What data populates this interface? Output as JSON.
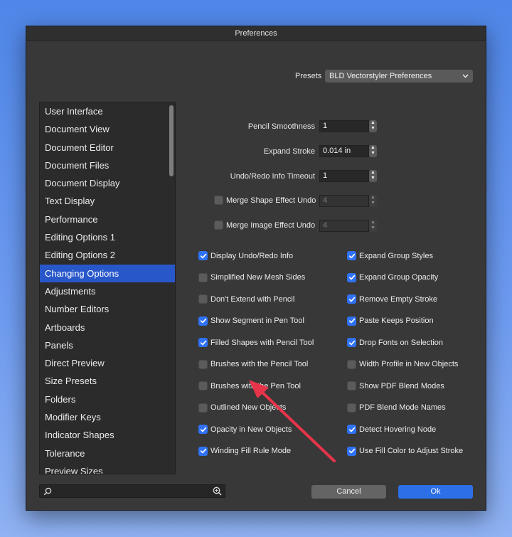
{
  "window": {
    "title": "Preferences"
  },
  "presets": {
    "label": "Presets",
    "selected": "BLD Vectorstyler Preferences"
  },
  "sidebar": {
    "items": [
      {
        "label": "User Interface"
      },
      {
        "label": "Document View"
      },
      {
        "label": "Document Editor"
      },
      {
        "label": "Document Files"
      },
      {
        "label": "Document Display"
      },
      {
        "label": "Text Display"
      },
      {
        "label": "Performance"
      },
      {
        "label": "Editing Options 1"
      },
      {
        "label": "Editing Options 2"
      },
      {
        "label": "Changing Options",
        "selected": true
      },
      {
        "label": "Adjustments"
      },
      {
        "label": "Number Editors"
      },
      {
        "label": "Artboards"
      },
      {
        "label": "Panels"
      },
      {
        "label": "Direct Preview"
      },
      {
        "label": "Size Presets"
      },
      {
        "label": "Folders"
      },
      {
        "label": "Modifier Keys"
      },
      {
        "label": "Indicator Shapes"
      },
      {
        "label": "Tolerance"
      },
      {
        "label": "Preview Sizes"
      }
    ]
  },
  "search": {
    "placeholder": ""
  },
  "fields": {
    "pencil_smoothness": {
      "label": "Pencil Smoothness",
      "value": "1"
    },
    "expand_stroke": {
      "label": "Expand Stroke",
      "value": "0.014 in"
    },
    "undo_redo_timeout": {
      "label": "Undo/Redo Info Timeout",
      "value": "1"
    },
    "merge_shape_effect_undo": {
      "label": "Merge Shape Effect Undo",
      "value": "4",
      "checked": false
    },
    "merge_image_effect_undo": {
      "label": "Merge Image Effect Undo",
      "value": "4",
      "checked": false
    }
  },
  "options_left": [
    {
      "label": "Display Undo/Redo Info",
      "checked": true
    },
    {
      "label": "Simplified New Mesh Sides",
      "checked": false
    },
    {
      "label": "Don't Extend with Pencil",
      "checked": false
    },
    {
      "label": "Show Segment in Pen Tool",
      "checked": true
    },
    {
      "label": "Filled Shapes with Pencil Tool",
      "checked": true
    },
    {
      "label": "Brushes with the Pencil Tool",
      "checked": false
    },
    {
      "label": "Brushes with the Pen Tool",
      "checked": false
    },
    {
      "label": "Outlined New Objects",
      "checked": false
    },
    {
      "label": "Opacity in New Objects",
      "checked": true
    },
    {
      "label": "Winding Fill Rule Mode",
      "checked": true
    }
  ],
  "options_right": [
    {
      "label": "Expand Group Styles",
      "checked": true
    },
    {
      "label": "Expand Group Opacity",
      "checked": true
    },
    {
      "label": "Remove Empty Stroke",
      "checked": true
    },
    {
      "label": "Paste Keeps Position",
      "checked": true
    },
    {
      "label": "Drop Fonts on Selection",
      "checked": true
    },
    {
      "label": "Width Profile in New Objects",
      "checked": false
    },
    {
      "label": "Show PDF Blend Modes",
      "checked": false
    },
    {
      "label": "PDF Blend Mode Names",
      "checked": false
    },
    {
      "label": "Detect Hovering Node",
      "checked": true
    },
    {
      "label": "Use Fill Color to Adjust Stroke",
      "checked": true
    }
  ],
  "buttons": {
    "cancel": "Cancel",
    "ok": "Ok"
  },
  "colors": {
    "accent": "#2f72f5",
    "selection": "#2857c9",
    "annotation_arrow": "#e8344a"
  }
}
